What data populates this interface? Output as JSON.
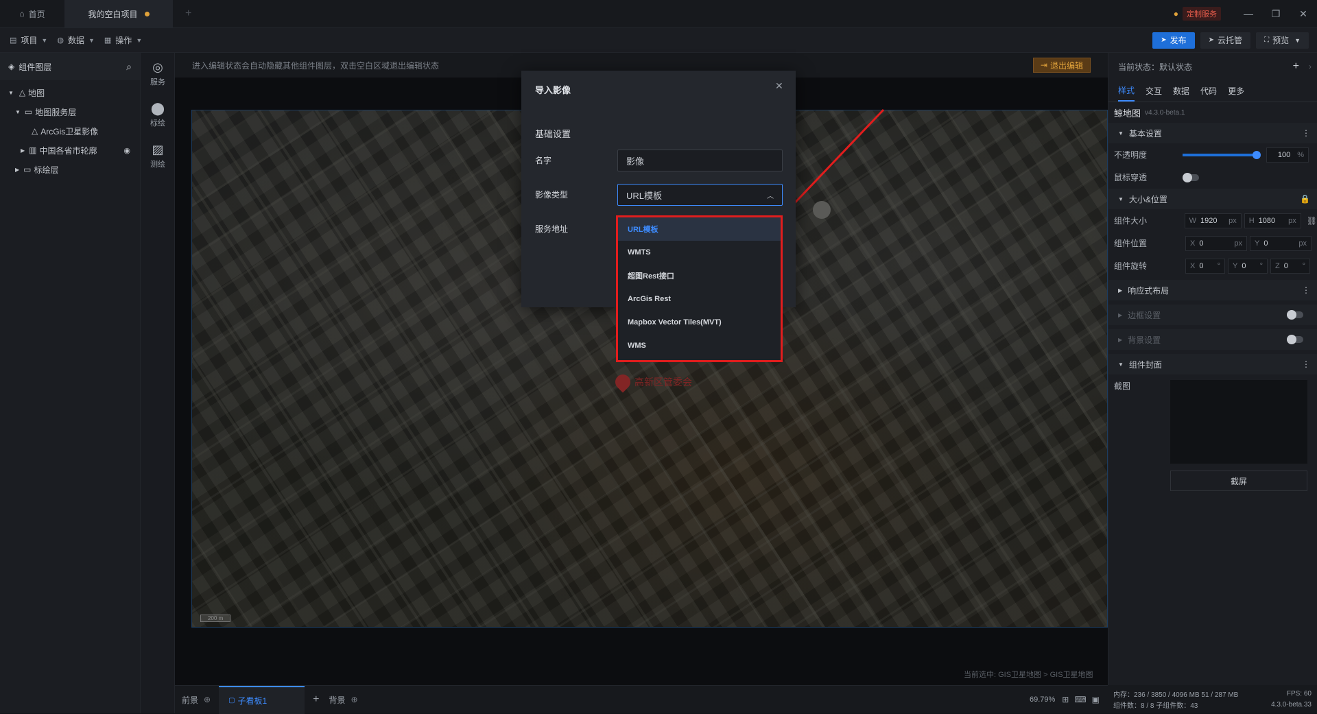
{
  "titlebar": {
    "home_tab": "首页",
    "project_tab": "我的空白项目",
    "custom_service": "定制服务",
    "accent": "#e0a23a"
  },
  "menubar": {
    "menus": [
      {
        "label": "项目",
        "icon": "file-icon"
      },
      {
        "label": "数据",
        "icon": "database-icon"
      },
      {
        "label": "操作",
        "icon": "grid-icon"
      }
    ],
    "publish": "发布",
    "cloud": "云托管",
    "preview": "预览",
    "publish_color": "#1e6fd9"
  },
  "left": {
    "title": "组件图层",
    "tree": [
      {
        "label": "地图",
        "icon": "map-icon",
        "indent": 0
      },
      {
        "label": "地图服务层",
        "icon": "folder-icon",
        "indent": 1
      },
      {
        "label": "ArcGis卫星影像",
        "icon": "map-icon",
        "indent": 2
      },
      {
        "label": "中国各省市轮廓",
        "icon": "book-icon",
        "indent": 2
      },
      {
        "label": "标绘层",
        "icon": "folder-icon",
        "indent": 1
      }
    ],
    "rail": [
      {
        "label": "服务",
        "icon": "globe-icon"
      },
      {
        "label": "标绘",
        "icon": "pin-icon"
      },
      {
        "label": "测绘",
        "icon": "ruler-icon"
      }
    ]
  },
  "editbar": {
    "message": "进入编辑状态会自动隐藏其他组件图层，双击空白区域退出编辑状态",
    "exit": "退出编辑"
  },
  "map": {
    "label": "高新区管委会",
    "scale": "200 m",
    "breadcrumb": "当前选中: GIS卫星地图 > GIS卫星地图"
  },
  "modal": {
    "title": "导入影像",
    "section": "基础设置",
    "name_label": "名字",
    "name_value": "影像",
    "type_label": "影像类型",
    "type_value": "URL模板",
    "url_label": "服务地址"
  },
  "dropdown": {
    "options": [
      "URL模板",
      "WMTS",
      "超图Rest接口",
      "ArcGis Rest",
      "Mapbox Vector Tiles(MVT)",
      "WMS"
    ],
    "selected": "URL模板",
    "highlight_color": "#e11d1d"
  },
  "bottombar": {
    "front": "前景",
    "sub_panel": "子看板1",
    "background": "背景",
    "zoom": "69.79%"
  },
  "right": {
    "state_label": "当前状态：默认状态",
    "tabs": [
      "样式",
      "交互",
      "数据",
      "代码",
      "更多"
    ],
    "component_name": "鲸地图",
    "version": "v4.3.0-beta.1",
    "basic_settings": "基本设置",
    "opacity_label": "不透明度",
    "opacity_value": "100",
    "opacity_unit": "%",
    "opacity_fraction": 1.0,
    "mouse_through": "鼠标穿透",
    "size_pos": "大小&位置",
    "size_label": "组件大小",
    "w_label": "W",
    "w_value": "1920",
    "h_label": "H",
    "h_value": "1080",
    "px": "px",
    "pos_label": "组件位置",
    "x_label": "X",
    "x_value": "0",
    "y_label": "Y",
    "y_value": "0",
    "rot_label": "组件旋转",
    "rx": "0",
    "ry": "0",
    "rz": "0",
    "z_label": "Z",
    "deg": "°",
    "responsive": "响应式布局",
    "border": "边框设置",
    "bg": "背景设置",
    "cover": "组件封面",
    "screenshot_label": "截图",
    "screenshot_btn": "截屏"
  },
  "status": {
    "memory": "内存：236 / 3850 / 4096 MB  51 / 287 MB",
    "fps": "FPS:  60",
    "components": "组件数：8 / 8   子组件数：43",
    "version": "4.3.0-beta.33"
  }
}
